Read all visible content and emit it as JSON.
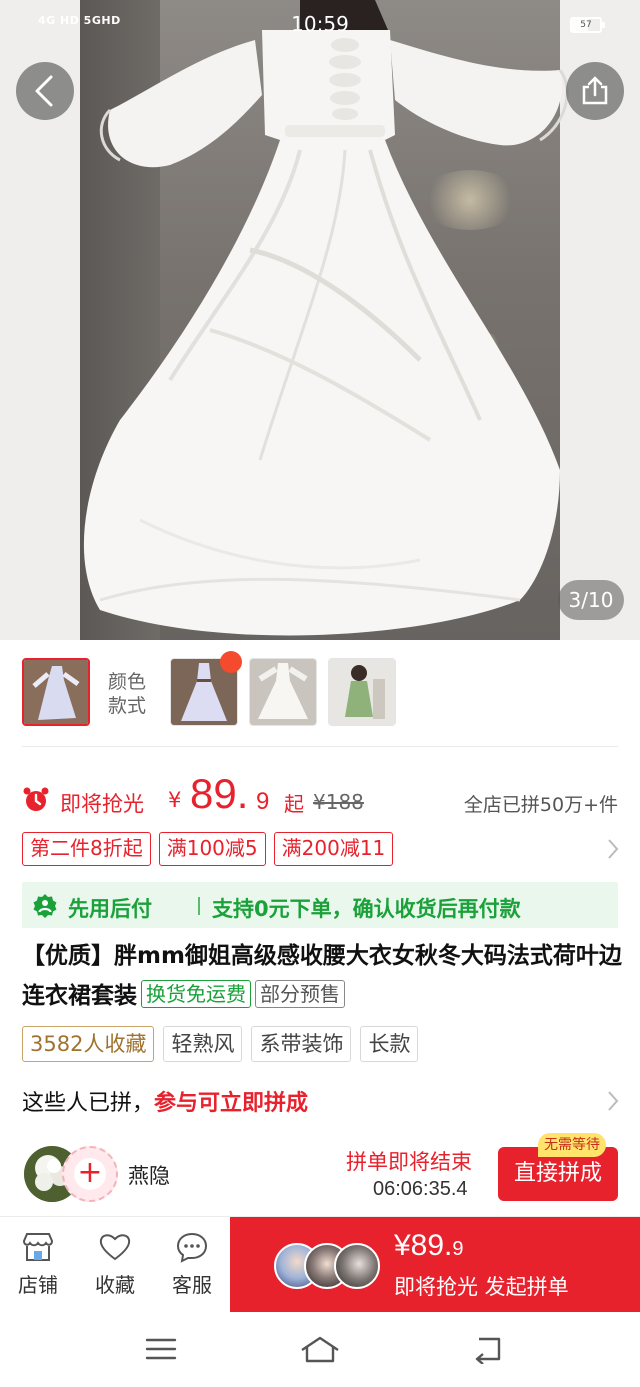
{
  "status_bar": {
    "network": "4G HD  5GHD",
    "time": "10:59",
    "battery_level": 0.57,
    "battery_text": "57"
  },
  "hero": {
    "image_counter": "3/10",
    "back_icon": "chevron-left-icon",
    "share_icon": "share-icon"
  },
  "variants": {
    "label_line1": "颜色",
    "label_line2": "款式",
    "thumbnail_count": 4
  },
  "price": {
    "flash_label": "即将抢光",
    "currency": "¥",
    "integer": "89.",
    "decimal": "9",
    "suffix": "起",
    "original": "¥188",
    "sold_text": "全店已拼50万+件",
    "accent_color": "#e8222d"
  },
  "coupons": [
    "第二件8折起",
    "满100减5",
    "满200减11"
  ],
  "pay_later": {
    "title": "先用后付",
    "description": "支持0元下单，确认收货后再付款",
    "color": "#1aa13a"
  },
  "product": {
    "title": "【优质】胖mm御姐高级感收腰大衣女秋冬大码法式荷叶边连衣裙套装",
    "tag_free_return": "换货免运费",
    "tag_presale": "部分预售"
  },
  "attributes": {
    "favorites": "3582人收藏",
    "tags": [
      "轻熟风",
      "系带装饰",
      "长款"
    ]
  },
  "group_buy": {
    "heading": "这些人已拼，",
    "heading_highlight": "参与可立即拼成",
    "user_name": "燕隐",
    "ending_label": "拼单即将结束",
    "countdown": "06:06:35.4",
    "join_button": "直接拼成",
    "no_wait_badge": "无需等待"
  },
  "bottom_bar": {
    "store": "店铺",
    "favorite": "收藏",
    "service": "客服",
    "buy_price_int": "¥89.",
    "buy_price_dec": "9",
    "buy_label": "即将抢光 发起拼单"
  }
}
